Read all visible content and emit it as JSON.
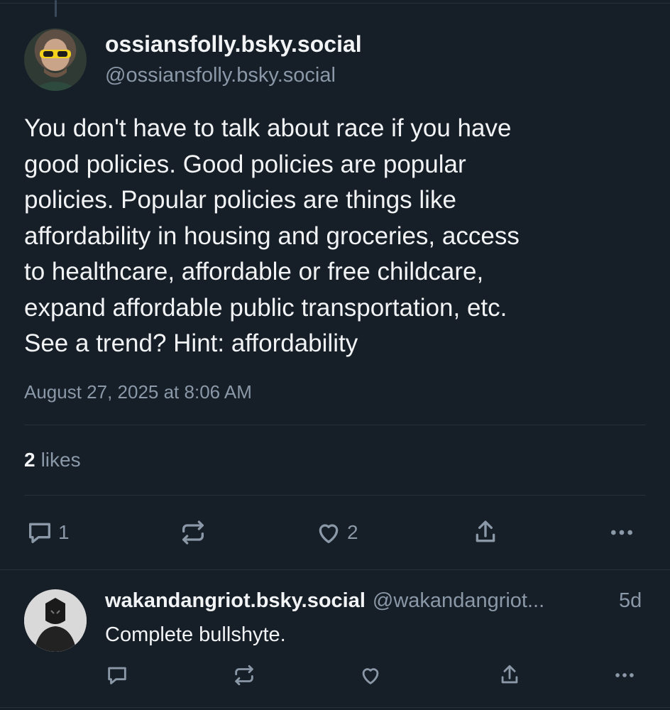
{
  "post": {
    "display_name": "ossiansfolly.bsky.social",
    "handle": "@ossiansfolly.bsky.social",
    "text_lines": [
      "You don't have to talk about race if you have",
      "good policies. Good policies are popular",
      "policies. Popular policies are things like",
      "affordability in housing and groceries, access",
      "to healthcare, affordable or free childcare,",
      "expand affordable public transportation, etc.",
      "See a trend? Hint: affordability"
    ],
    "timestamp": "August 27, 2025 at 8:06 AM",
    "likes_count": "2",
    "likes_label": "likes",
    "actions": {
      "reply_count": "1",
      "repost_count": "",
      "like_count": "2"
    }
  },
  "reply": {
    "display_name": "wakandangriot.bsky.social",
    "handle": "@wakandangriot...",
    "age": "5d",
    "text": "Complete bullshyte."
  },
  "icons": {
    "reply": "comment-icon",
    "repost": "repost-icon",
    "like": "heart-icon",
    "share": "share-icon",
    "more": "more-icon"
  },
  "colors": {
    "background": "#161e27",
    "primary_text": "#f1f3f5",
    "secondary_text": "#8a98a8",
    "divider": "#26313d"
  }
}
